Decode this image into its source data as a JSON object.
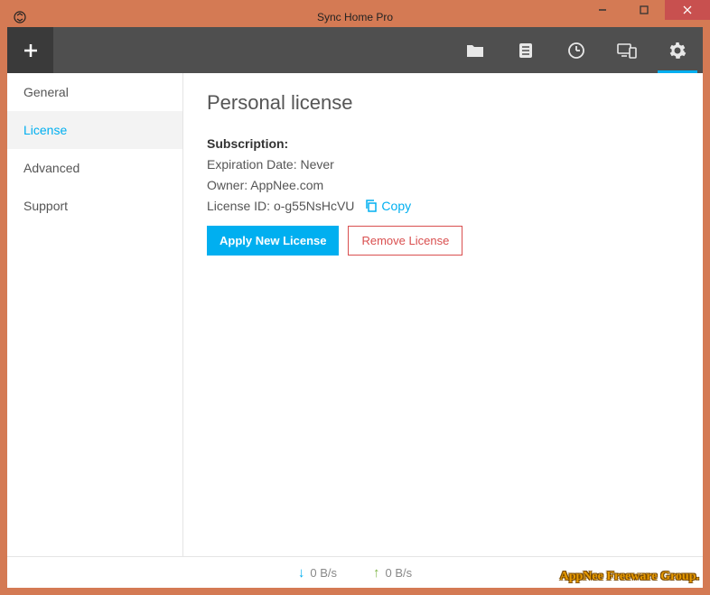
{
  "titlebar": {
    "title": "Sync Home Pro"
  },
  "sidebar": {
    "items": [
      {
        "label": "General",
        "active": false
      },
      {
        "label": "License",
        "active": true
      },
      {
        "label": "Advanced",
        "active": false
      },
      {
        "label": "Support",
        "active": false
      }
    ]
  },
  "main": {
    "page_title": "Personal license",
    "subscription_label": "Subscription:",
    "expiration_label": "Expiration Date:",
    "expiration_value": "Never",
    "owner_label": "Owner:",
    "owner_value": "AppNee.com",
    "license_id_label": "License ID:",
    "license_id_value": "o-g55NsHcVU",
    "copy_label": "Copy",
    "apply_button": "Apply New License",
    "remove_button": "Remove License"
  },
  "statusbar": {
    "download": "0 B/s",
    "upload": "0 B/s"
  },
  "watermark": "AppNee Freeware Group."
}
